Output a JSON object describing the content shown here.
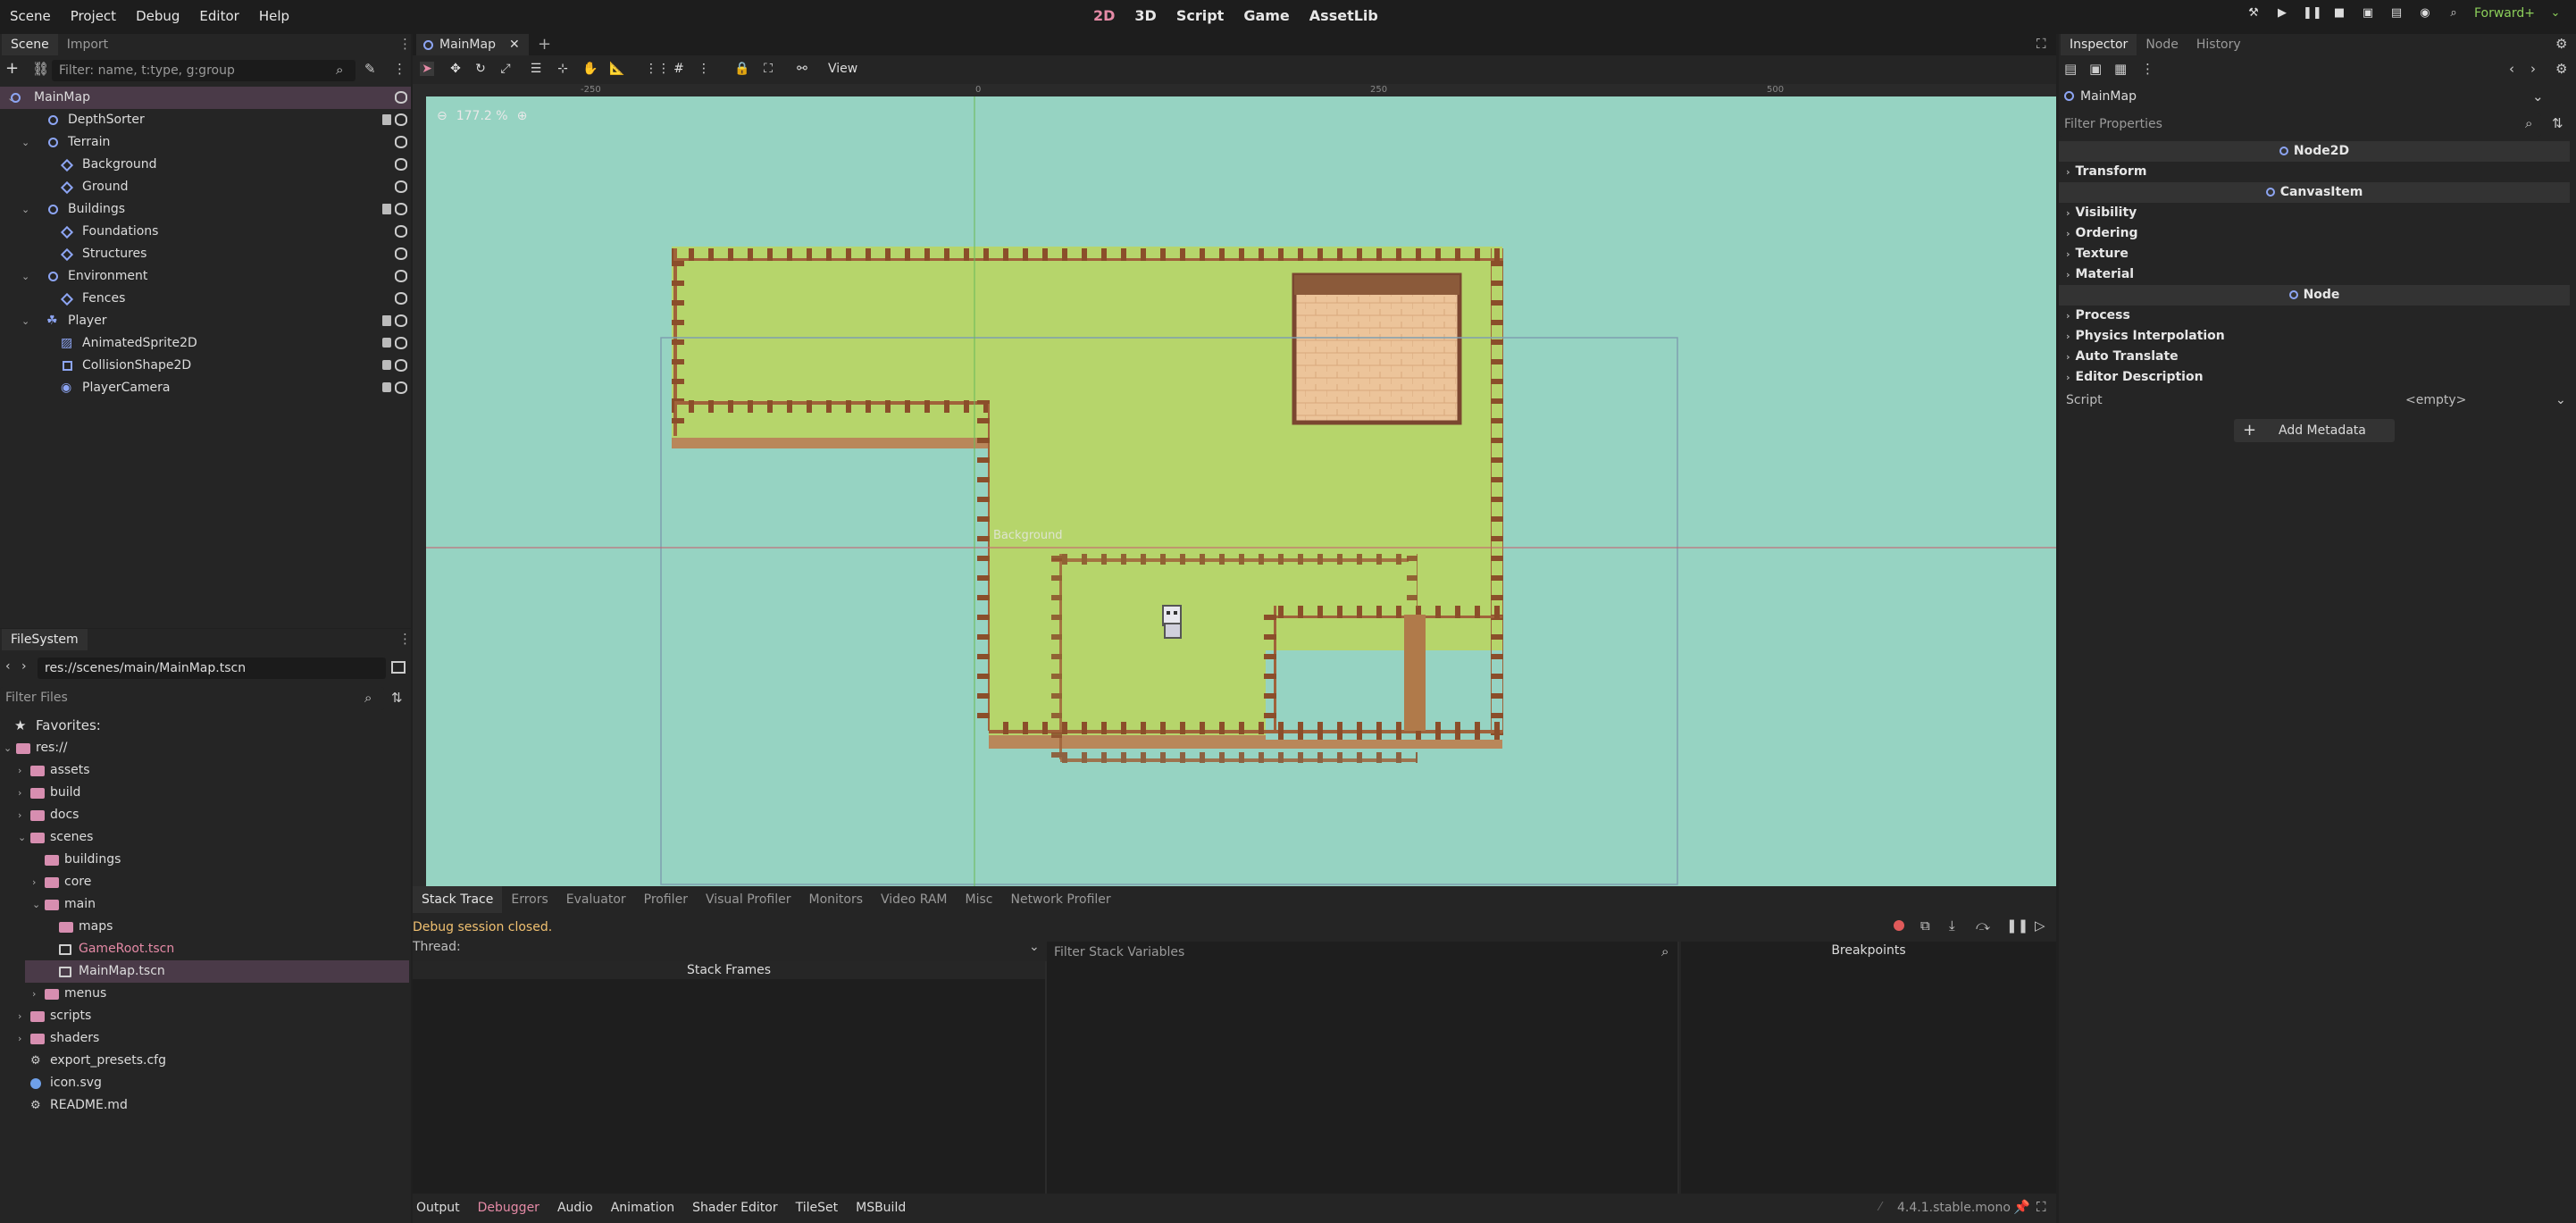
{
  "menu": [
    "Scene",
    "Project",
    "Debug",
    "Editor",
    "Help"
  ],
  "modes": [
    "2D",
    "3D",
    "Script",
    "Game",
    "AssetLib"
  ],
  "renderer": "Forward+",
  "scene_tabs": [
    "Scene",
    "Import"
  ],
  "scene_filter": "Filter: name, t:type, g:group",
  "scene_tree": [
    {
      "label": "MainMap",
      "icon": "node-circle-icon",
      "indent": 0,
      "arrow": "v",
      "selected": true,
      "script": false
    },
    {
      "label": "DepthSorter",
      "icon": "node-circle-icon",
      "indent": 1,
      "script": true
    },
    {
      "label": "Terrain",
      "icon": "node-circle-icon",
      "indent": 1,
      "arrow": "v"
    },
    {
      "label": "Background",
      "icon": "tilemap-icon",
      "indent": 2
    },
    {
      "label": "Ground",
      "icon": "tilemap-icon",
      "indent": 2
    },
    {
      "label": "Buildings",
      "icon": "node-circle-icon",
      "indent": 1,
      "arrow": "v",
      "script": true
    },
    {
      "label": "Foundations",
      "icon": "tilemap-icon",
      "indent": 2
    },
    {
      "label": "Structures",
      "icon": "tilemap-icon",
      "indent": 2
    },
    {
      "label": "Environment",
      "icon": "node-circle-icon",
      "indent": 1,
      "arrow": "v"
    },
    {
      "label": "Fences",
      "icon": "tilemap-icon",
      "indent": 2
    },
    {
      "label": "Player",
      "icon": "character-body-icon",
      "indent": 1,
      "arrow": "v",
      "script": true
    },
    {
      "label": "AnimatedSprite2D",
      "icon": "animated-sprite-icon",
      "indent": 2,
      "lock": true
    },
    {
      "label": "CollisionShape2D",
      "icon": "collision-shape-icon",
      "indent": 2,
      "lock": true
    },
    {
      "label": "PlayerCamera",
      "icon": "camera-icon",
      "indent": 2,
      "lock": true
    }
  ],
  "filesystem": {
    "title": "FileSystem",
    "path": "res://scenes/main/MainMap.tscn",
    "filter": "Filter Files",
    "favorites": "Favorites:",
    "items": [
      {
        "label": "res://",
        "type": "folder",
        "indent": 0,
        "arrow": "v"
      },
      {
        "label": "assets",
        "type": "folder",
        "indent": 1,
        "arrow": ">"
      },
      {
        "label": "build",
        "type": "folder",
        "indent": 1,
        "arrow": ">"
      },
      {
        "label": "docs",
        "type": "folder",
        "indent": 1,
        "arrow": ">"
      },
      {
        "label": "scenes",
        "type": "folder",
        "indent": 1,
        "arrow": "v"
      },
      {
        "label": "buildings",
        "type": "folder",
        "indent": 2
      },
      {
        "label": "core",
        "type": "folder",
        "indent": 2,
        "arrow": ">"
      },
      {
        "label": "main",
        "type": "folder",
        "indent": 2,
        "arrow": "v"
      },
      {
        "label": "maps",
        "type": "folder",
        "indent": 3
      },
      {
        "label": "GameRoot.tscn",
        "type": "scene",
        "indent": 3,
        "color": "#e58aa6"
      },
      {
        "label": "MainMap.tscn",
        "type": "scene",
        "indent": 3,
        "selected": true
      },
      {
        "label": "menus",
        "type": "folder",
        "indent": 2,
        "arrow": ">"
      },
      {
        "label": "scripts",
        "type": "folder",
        "indent": 1,
        "arrow": ">"
      },
      {
        "label": "shaders",
        "type": "folder",
        "indent": 1,
        "arrow": ">"
      },
      {
        "label": "export_presets.cfg",
        "type": "config",
        "indent": 1
      },
      {
        "label": "icon.svg",
        "type": "image",
        "indent": 1
      },
      {
        "label": "README.md",
        "type": "config",
        "indent": 1
      }
    ]
  },
  "editor_tab": "MainMap",
  "view_menu": "View",
  "zoom": "177.2 %",
  "ruler_marks": [
    "-250",
    "0",
    "250",
    "500"
  ],
  "canvas_label": "Background",
  "inspector": {
    "tabs": [
      "Inspector",
      "Node",
      "History"
    ],
    "node_name": "MainMap",
    "filter": "Filter Properties",
    "sections": [
      {
        "kind": "header",
        "label": "Node2D"
      },
      {
        "kind": "sec",
        "label": "Transform"
      },
      {
        "kind": "header",
        "label": "CanvasItem"
      },
      {
        "kind": "sec",
        "label": "Visibility"
      },
      {
        "kind": "sec",
        "label": "Ordering"
      },
      {
        "kind": "sec",
        "label": "Texture"
      },
      {
        "kind": "sec",
        "label": "Material"
      },
      {
        "kind": "header",
        "label": "Node"
      },
      {
        "kind": "sec",
        "label": "Process"
      },
      {
        "kind": "sec",
        "label": "Physics Interpolation"
      },
      {
        "kind": "sec",
        "label": "Auto Translate"
      },
      {
        "kind": "sec",
        "label": "Editor Description"
      }
    ],
    "script_label": "Script",
    "script_value": "<empty>",
    "add_metadata": "Add Metadata"
  },
  "debugger": {
    "tabs": [
      "Stack Trace",
      "Errors",
      "Evaluator",
      "Profiler",
      "Visual Profiler",
      "Monitors",
      "Video RAM",
      "Misc",
      "Network Profiler"
    ],
    "status": "Debug session closed.",
    "thread": "Thread:",
    "stack_frames": "Stack Frames",
    "filter_vars": "Filter Stack Variables",
    "breakpoints": "Breakpoints"
  },
  "bottom_tabs": [
    "Output",
    "Debugger",
    "Audio",
    "Animation",
    "Shader Editor",
    "TileSet",
    "MSBuild"
  ],
  "version": "4.4.1.stable.mono",
  "colors": {
    "accent": "#e58aa6",
    "water": "#96d3c2",
    "grass": "#b7d66b",
    "fence": "#9b5a34"
  }
}
